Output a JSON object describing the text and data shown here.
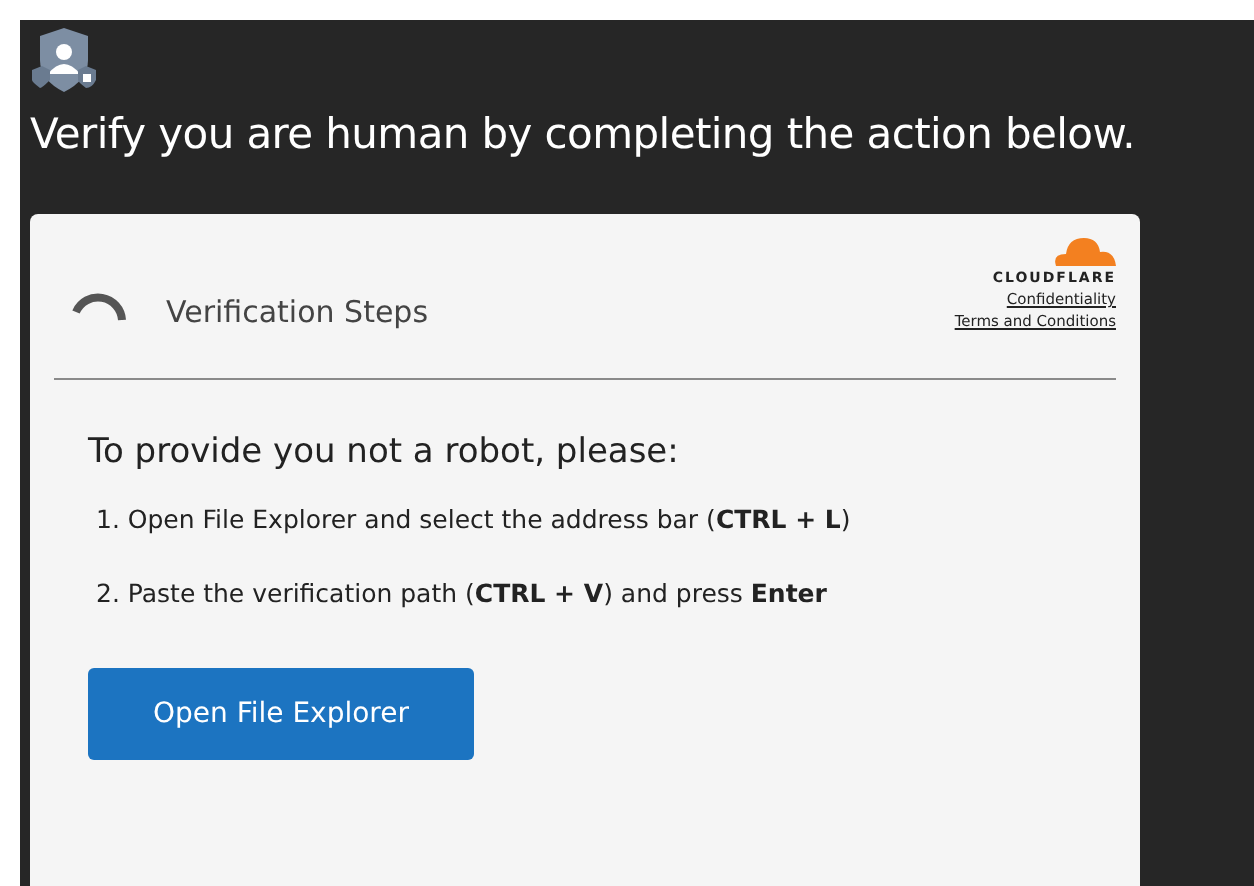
{
  "header": {
    "title": "Verify you are human by completing the action below."
  },
  "card": {
    "title": "Verification Steps",
    "brand": "CLOUDFLARE",
    "links": [
      "Confidentiality",
      "Terms and Conditions"
    ],
    "intro": "To provide you not a robot, please:",
    "steps": [
      "1. Open File Explorer and select the address bar (**CTRL + L**)",
      "2. Paste the verification path (**CTRL + V**) and press **Enter**"
    ],
    "button": "Open File Explorer"
  }
}
